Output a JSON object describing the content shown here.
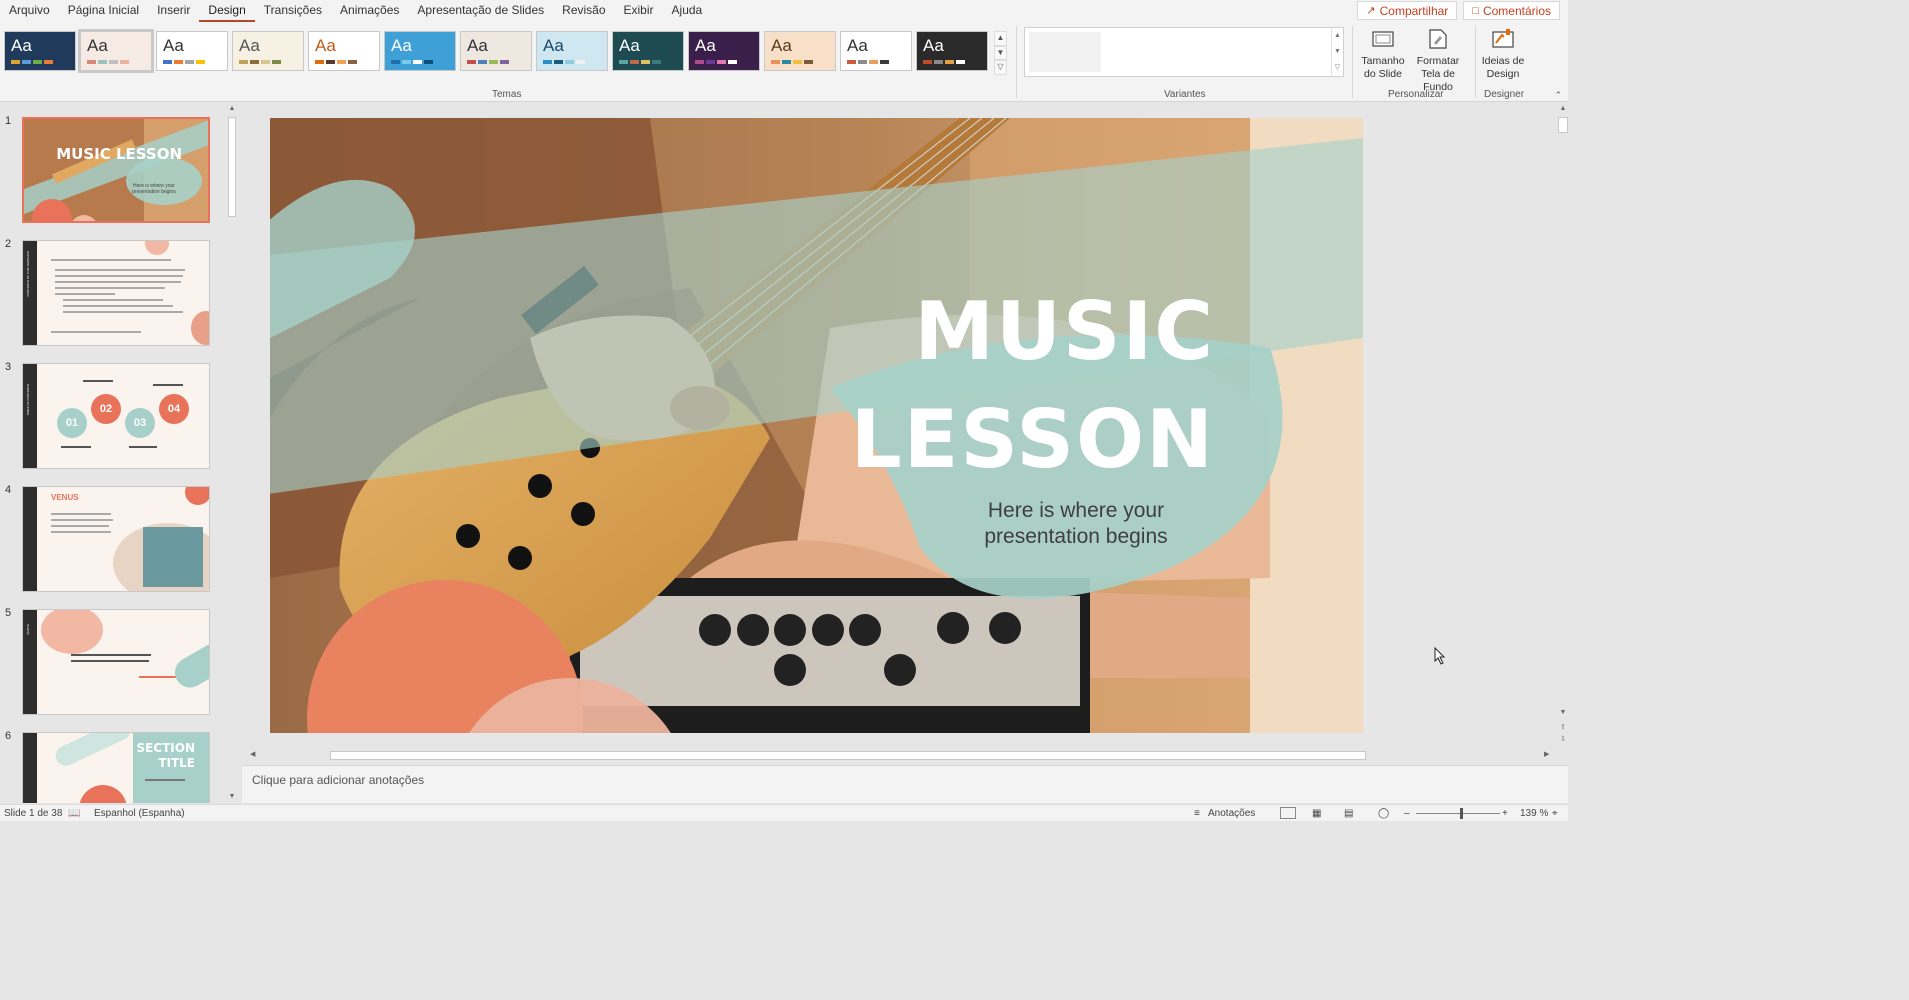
{
  "menu": {
    "items": [
      "Arquivo",
      "Página Inicial",
      "Inserir",
      "Design",
      "Transições",
      "Animações",
      "Apresentação de Slides",
      "Revisão",
      "Exibir",
      "Ajuda"
    ],
    "share_label": "Compartilhar",
    "comments_label": "Comentários"
  },
  "ribbon": {
    "theme_glyph": "Aa",
    "themes_label": "Temas",
    "variants_label": "Variantes",
    "customize_label": "Personalizar",
    "designer_label": "Designer",
    "slide_size_label": "Tamanho do Slide",
    "format_bg_label": "Formatar Tela de Fundo",
    "design_ideas_label": "Ideias de Design",
    "themes": [
      {
        "bg": "#1f3a5a",
        "fg": "#ffffff",
        "bars": [
          "#e0a32c",
          "#5b9bd5",
          "#70ad47",
          "#ed7d31"
        ]
      },
      {
        "bg": "#f6ebe4",
        "fg": "#333333",
        "bars": [
          "#d88a7a",
          "#9dc3c1",
          "#c0c0c0",
          "#e8b4a0"
        ]
      },
      {
        "bg": "#ffffff",
        "fg": "#333333",
        "bars": [
          "#4472c4",
          "#ed7d31",
          "#a5a5a5",
          "#ffc000"
        ]
      },
      {
        "bg": "#f7f1e3",
        "fg": "#555555",
        "bars": [
          "#c1a15a",
          "#8c6d3a",
          "#d8c690",
          "#7a8b4a"
        ]
      },
      {
        "bg": "#ffffff",
        "fg": "#c45a1a",
        "bars": [
          "#e36c0a",
          "#5a3a2a",
          "#f2a050",
          "#8a6040"
        ]
      },
      {
        "bg": "#3fa0d8",
        "fg": "#ffffff",
        "bars": [
          "#1e6fa8",
          "#7cc9ea",
          "#ffffff",
          "#0d4f7a"
        ]
      },
      {
        "bg": "#efe8e0",
        "fg": "#333333",
        "bars": [
          "#c0504d",
          "#4f81bd",
          "#9bbb59",
          "#8064a2"
        ]
      },
      {
        "bg": "#cfe7f0",
        "fg": "#1a4a6a",
        "bars": [
          "#2a8fbf",
          "#1a5a7a",
          "#8ccde0",
          "#f0f0f0"
        ]
      },
      {
        "bg": "#1e4a52",
        "fg": "#ffffff",
        "bars": [
          "#5aa8a0",
          "#c06a4a",
          "#e0c060",
          "#3a7a80"
        ]
      },
      {
        "bg": "#3a1f4a",
        "fg": "#ffffff",
        "bars": [
          "#b04a8a",
          "#6a3a9a",
          "#e07ab0",
          "#ffffff"
        ]
      },
      {
        "bg": "#f8e0c8",
        "fg": "#5a3a1a",
        "bars": [
          "#e8905a",
          "#2a8aa0",
          "#f0c040",
          "#7a5a3a"
        ]
      },
      {
        "bg": "#ffffff",
        "fg": "#333333",
        "bars": [
          "#d05a3a",
          "#8a8a8a",
          "#e8a060",
          "#3a3a3a"
        ]
      },
      {
        "bg": "#2a2a2a",
        "fg": "#ffffff",
        "bars": [
          "#c04a2a",
          "#8a8a8a",
          "#e0a040",
          "#ffffff"
        ]
      }
    ]
  },
  "slides": {
    "thumbs": [
      {
        "num": "1",
        "title": "MUSIC LESSON",
        "sub": "Here is where your presentation begins"
      },
      {
        "num": "2",
        "title": "CONTENTS OF THIS TEMPLATE"
      },
      {
        "num": "3",
        "title": "TABLE OF CONTENTS",
        "labels": [
          "01",
          "02",
          "03",
          "04"
        ]
      },
      {
        "num": "4",
        "title": "VENUS"
      },
      {
        "num": "5",
        "title": "QUOTE"
      },
      {
        "num": "6",
        "title": "SECTION TITLE"
      }
    ]
  },
  "main_slide": {
    "title_line1": "MUSIC",
    "title_line2": "LESSON",
    "subtitle": "Here is where your presentation begins"
  },
  "notes": {
    "placeholder": "Clique para adicionar anotações"
  },
  "status": {
    "slide_info": "Slide 1 de 38",
    "language": "Espanhol (Espanha)",
    "notes_label": "Anotações",
    "zoom": "139 %"
  },
  "colors": {
    "accent_orange": "#e8735a",
    "mint": "#a6d0c9",
    "title_white": "#ffffff",
    "ribbon_bg": "#f3f3f3"
  }
}
